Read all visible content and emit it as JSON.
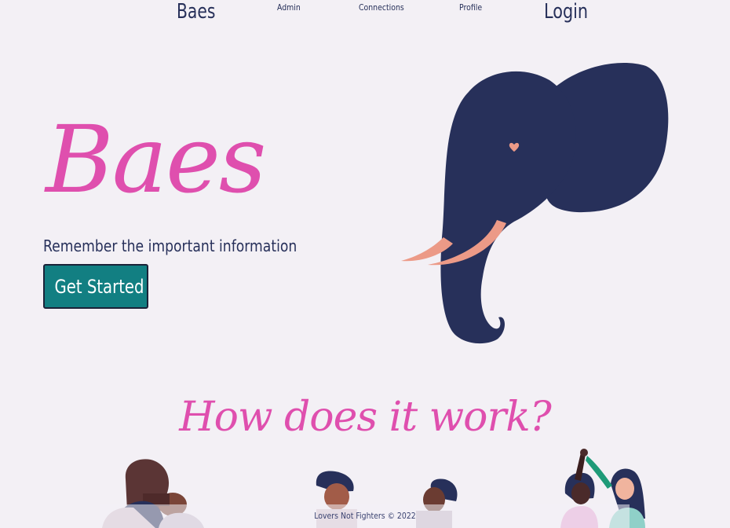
{
  "nav": {
    "brand": "Baes",
    "admin": "Admin",
    "connections": "Connections",
    "profile": "Profile",
    "login": "Login"
  },
  "hero": {
    "title": "Baes",
    "subtitle": "Remember the important information",
    "cta_label": "Get Started"
  },
  "section": {
    "heading": "How does it work?"
  },
  "footer": {
    "text": "Lovers Not Fighters © 2022"
  },
  "colors": {
    "background": "#f3f0f5",
    "accent_pink": "#df4fae",
    "navy": "#27305a",
    "teal_button": "#127f82",
    "tusk": "#ec9a87"
  },
  "icons": [
    "elephant-illustration",
    "heart-icon",
    "hugging-couple-illustration",
    "talking-couple-illustration",
    "dancing-couple-illustration"
  ]
}
